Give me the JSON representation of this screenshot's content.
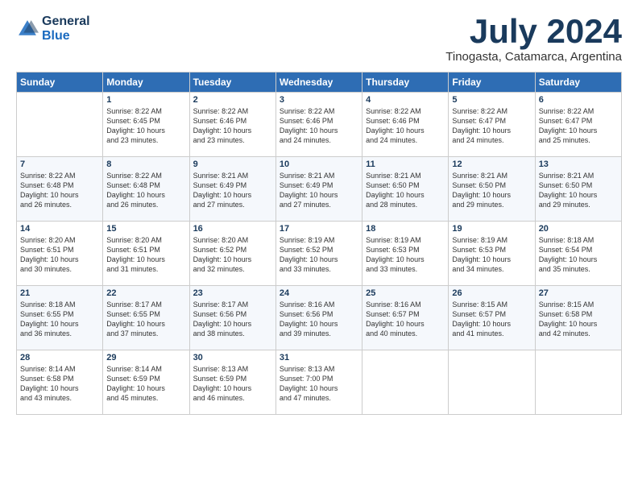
{
  "logo": {
    "line1": "General",
    "line2": "Blue"
  },
  "title": "July 2024",
  "location": "Tinogasta, Catamarca, Argentina",
  "days_of_week": [
    "Sunday",
    "Monday",
    "Tuesday",
    "Wednesday",
    "Thursday",
    "Friday",
    "Saturday"
  ],
  "weeks": [
    [
      {
        "day": "",
        "data": ""
      },
      {
        "day": "1",
        "data": "Sunrise: 8:22 AM\nSunset: 6:45 PM\nDaylight: 10 hours\nand 23 minutes."
      },
      {
        "day": "2",
        "data": "Sunrise: 8:22 AM\nSunset: 6:46 PM\nDaylight: 10 hours\nand 23 minutes."
      },
      {
        "day": "3",
        "data": "Sunrise: 8:22 AM\nSunset: 6:46 PM\nDaylight: 10 hours\nand 24 minutes."
      },
      {
        "day": "4",
        "data": "Sunrise: 8:22 AM\nSunset: 6:46 PM\nDaylight: 10 hours\nand 24 minutes."
      },
      {
        "day": "5",
        "data": "Sunrise: 8:22 AM\nSunset: 6:47 PM\nDaylight: 10 hours\nand 24 minutes."
      },
      {
        "day": "6",
        "data": "Sunrise: 8:22 AM\nSunset: 6:47 PM\nDaylight: 10 hours\nand 25 minutes."
      }
    ],
    [
      {
        "day": "7",
        "data": "Sunrise: 8:22 AM\nSunset: 6:48 PM\nDaylight: 10 hours\nand 26 minutes."
      },
      {
        "day": "8",
        "data": "Sunrise: 8:22 AM\nSunset: 6:48 PM\nDaylight: 10 hours\nand 26 minutes."
      },
      {
        "day": "9",
        "data": "Sunrise: 8:21 AM\nSunset: 6:49 PM\nDaylight: 10 hours\nand 27 minutes."
      },
      {
        "day": "10",
        "data": "Sunrise: 8:21 AM\nSunset: 6:49 PM\nDaylight: 10 hours\nand 27 minutes."
      },
      {
        "day": "11",
        "data": "Sunrise: 8:21 AM\nSunset: 6:50 PM\nDaylight: 10 hours\nand 28 minutes."
      },
      {
        "day": "12",
        "data": "Sunrise: 8:21 AM\nSunset: 6:50 PM\nDaylight: 10 hours\nand 29 minutes."
      },
      {
        "day": "13",
        "data": "Sunrise: 8:21 AM\nSunset: 6:50 PM\nDaylight: 10 hours\nand 29 minutes."
      }
    ],
    [
      {
        "day": "14",
        "data": "Sunrise: 8:20 AM\nSunset: 6:51 PM\nDaylight: 10 hours\nand 30 minutes."
      },
      {
        "day": "15",
        "data": "Sunrise: 8:20 AM\nSunset: 6:51 PM\nDaylight: 10 hours\nand 31 minutes."
      },
      {
        "day": "16",
        "data": "Sunrise: 8:20 AM\nSunset: 6:52 PM\nDaylight: 10 hours\nand 32 minutes."
      },
      {
        "day": "17",
        "data": "Sunrise: 8:19 AM\nSunset: 6:52 PM\nDaylight: 10 hours\nand 33 minutes."
      },
      {
        "day": "18",
        "data": "Sunrise: 8:19 AM\nSunset: 6:53 PM\nDaylight: 10 hours\nand 33 minutes."
      },
      {
        "day": "19",
        "data": "Sunrise: 8:19 AM\nSunset: 6:53 PM\nDaylight: 10 hours\nand 34 minutes."
      },
      {
        "day": "20",
        "data": "Sunrise: 8:18 AM\nSunset: 6:54 PM\nDaylight: 10 hours\nand 35 minutes."
      }
    ],
    [
      {
        "day": "21",
        "data": "Sunrise: 8:18 AM\nSunset: 6:55 PM\nDaylight: 10 hours\nand 36 minutes."
      },
      {
        "day": "22",
        "data": "Sunrise: 8:17 AM\nSunset: 6:55 PM\nDaylight: 10 hours\nand 37 minutes."
      },
      {
        "day": "23",
        "data": "Sunrise: 8:17 AM\nSunset: 6:56 PM\nDaylight: 10 hours\nand 38 minutes."
      },
      {
        "day": "24",
        "data": "Sunrise: 8:16 AM\nSunset: 6:56 PM\nDaylight: 10 hours\nand 39 minutes."
      },
      {
        "day": "25",
        "data": "Sunrise: 8:16 AM\nSunset: 6:57 PM\nDaylight: 10 hours\nand 40 minutes."
      },
      {
        "day": "26",
        "data": "Sunrise: 8:15 AM\nSunset: 6:57 PM\nDaylight: 10 hours\nand 41 minutes."
      },
      {
        "day": "27",
        "data": "Sunrise: 8:15 AM\nSunset: 6:58 PM\nDaylight: 10 hours\nand 42 minutes."
      }
    ],
    [
      {
        "day": "28",
        "data": "Sunrise: 8:14 AM\nSunset: 6:58 PM\nDaylight: 10 hours\nand 43 minutes."
      },
      {
        "day": "29",
        "data": "Sunrise: 8:14 AM\nSunset: 6:59 PM\nDaylight: 10 hours\nand 45 minutes."
      },
      {
        "day": "30",
        "data": "Sunrise: 8:13 AM\nSunset: 6:59 PM\nDaylight: 10 hours\nand 46 minutes."
      },
      {
        "day": "31",
        "data": "Sunrise: 8:13 AM\nSunset: 7:00 PM\nDaylight: 10 hours\nand 47 minutes."
      },
      {
        "day": "",
        "data": ""
      },
      {
        "day": "",
        "data": ""
      },
      {
        "day": "",
        "data": ""
      }
    ]
  ]
}
